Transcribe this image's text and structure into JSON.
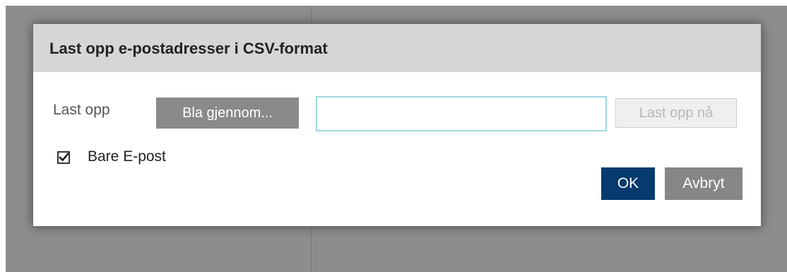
{
  "dialog": {
    "title": "Last opp e-postadresser i CSV-format",
    "upload_label": "Last opp",
    "browse_button": "Bla gjennom...",
    "file_input": {
      "value": "",
      "placeholder": ""
    },
    "upload_now_button": "Last opp nå",
    "email_only_checkbox": {
      "label": "Bare E-post",
      "checked": true
    },
    "ok_button": "OK",
    "cancel_button": "Avbryt"
  },
  "colors": {
    "ok_button": "#073a6e",
    "secondary_button": "#8a8a8a",
    "header_background": "#d6d6d6",
    "input_border": "#9fd8e0",
    "disabled_button_text": "#b7b7b7"
  }
}
